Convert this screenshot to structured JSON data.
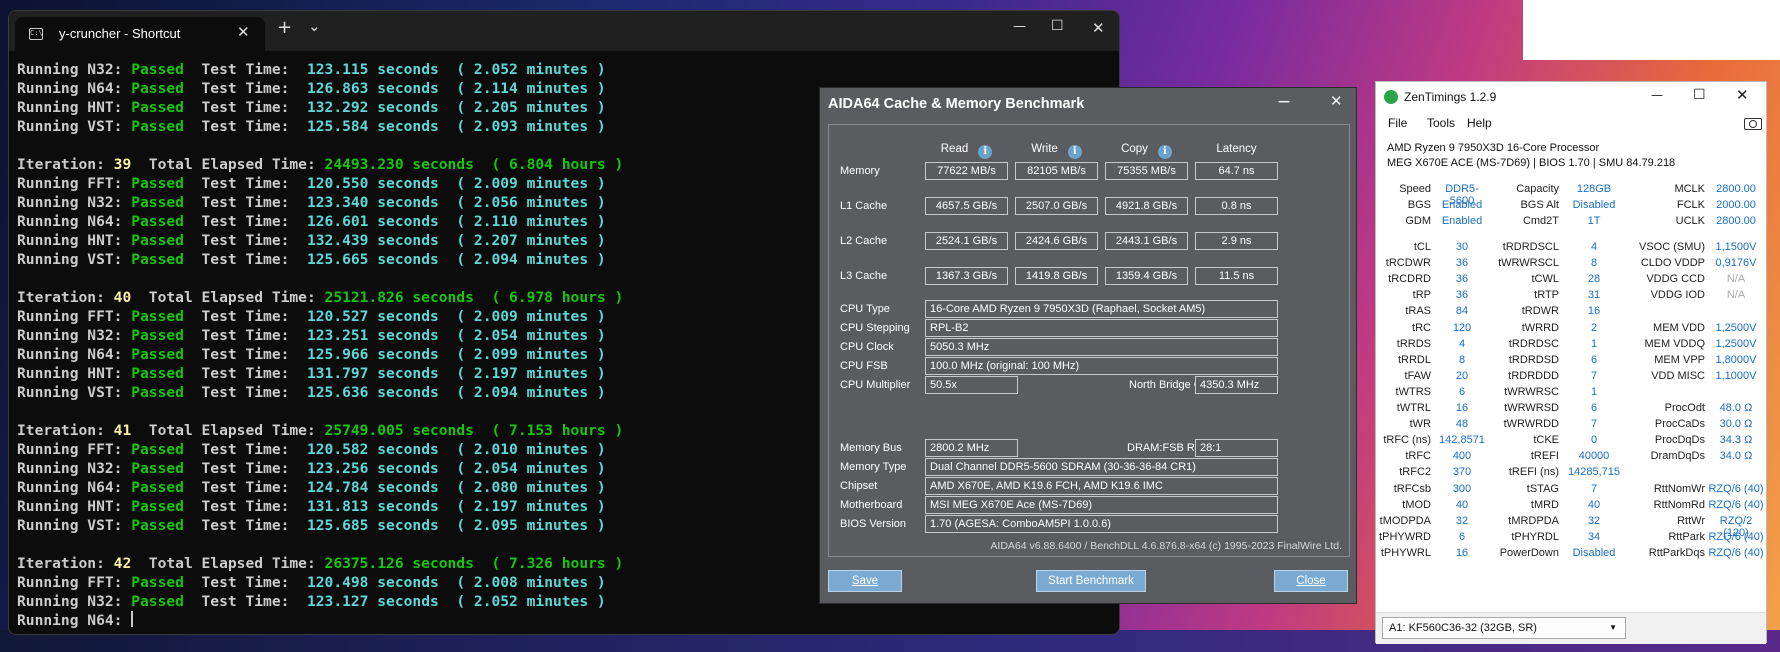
{
  "terminal": {
    "tab_title": "y-cruncher - Shortcut",
    "tab_close": "✕",
    "new_tab": "+",
    "dropdown": "⌄",
    "min": "—",
    "max": "☐",
    "close": "✕",
    "lines": [
      [
        [
          "w",
          "Running N32: "
        ],
        [
          "g",
          "Passed"
        ],
        [
          "w",
          "  Test Time:  "
        ],
        [
          "c",
          "123.115 seconds  ( 2.052 minutes )"
        ]
      ],
      [
        [
          "w",
          "Running N64: "
        ],
        [
          "g",
          "Passed"
        ],
        [
          "w",
          "  Test Time:  "
        ],
        [
          "c",
          "126.863 seconds  ( 2.114 minutes )"
        ]
      ],
      [
        [
          "w",
          "Running HNT: "
        ],
        [
          "g",
          "Passed"
        ],
        [
          "w",
          "  Test Time:  "
        ],
        [
          "c",
          "132.292 seconds  ( 2.205 minutes )"
        ]
      ],
      [
        [
          "w",
          "Running VST: "
        ],
        [
          "g",
          "Passed"
        ],
        [
          "w",
          "  Test Time:  "
        ],
        [
          "c",
          "125.584 seconds  ( 2.093 minutes )"
        ]
      ],
      [],
      [
        [
          "w",
          "Iteration: "
        ],
        [
          "y",
          "39"
        ],
        [
          "w",
          "  Total Elapsed Time: "
        ],
        [
          "g",
          "24493.230 seconds  ( 6.804 hours )"
        ]
      ],
      [
        [
          "w",
          "Running FFT: "
        ],
        [
          "g",
          "Passed"
        ],
        [
          "w",
          "  Test Time:  "
        ],
        [
          "c",
          "120.550 seconds  ( 2.009 minutes )"
        ]
      ],
      [
        [
          "w",
          "Running N32: "
        ],
        [
          "g",
          "Passed"
        ],
        [
          "w",
          "  Test Time:  "
        ],
        [
          "c",
          "123.340 seconds  ( 2.056 minutes )"
        ]
      ],
      [
        [
          "w",
          "Running N64: "
        ],
        [
          "g",
          "Passed"
        ],
        [
          "w",
          "  Test Time:  "
        ],
        [
          "c",
          "126.601 seconds  ( 2.110 minutes )"
        ]
      ],
      [
        [
          "w",
          "Running HNT: "
        ],
        [
          "g",
          "Passed"
        ],
        [
          "w",
          "  Test Time:  "
        ],
        [
          "c",
          "132.439 seconds  ( 2.207 minutes )"
        ]
      ],
      [
        [
          "w",
          "Running VST: "
        ],
        [
          "g",
          "Passed"
        ],
        [
          "w",
          "  Test Time:  "
        ],
        [
          "c",
          "125.665 seconds  ( 2.094 minutes )"
        ]
      ],
      [],
      [
        [
          "w",
          "Iteration: "
        ],
        [
          "y",
          "40"
        ],
        [
          "w",
          "  Total Elapsed Time: "
        ],
        [
          "g",
          "25121.826 seconds  ( 6.978 hours )"
        ]
      ],
      [
        [
          "w",
          "Running FFT: "
        ],
        [
          "g",
          "Passed"
        ],
        [
          "w",
          "  Test Time:  "
        ],
        [
          "c",
          "120.527 seconds  ( 2.009 minutes )"
        ]
      ],
      [
        [
          "w",
          "Running N32: "
        ],
        [
          "g",
          "Passed"
        ],
        [
          "w",
          "  Test Time:  "
        ],
        [
          "c",
          "123.251 seconds  ( 2.054 minutes )"
        ]
      ],
      [
        [
          "w",
          "Running N64: "
        ],
        [
          "g",
          "Passed"
        ],
        [
          "w",
          "  Test Time:  "
        ],
        [
          "c",
          "125.966 seconds  ( 2.099 minutes )"
        ]
      ],
      [
        [
          "w",
          "Running HNT: "
        ],
        [
          "g",
          "Passed"
        ],
        [
          "w",
          "  Test Time:  "
        ],
        [
          "c",
          "131.797 seconds  ( 2.197 minutes )"
        ]
      ],
      [
        [
          "w",
          "Running VST: "
        ],
        [
          "g",
          "Passed"
        ],
        [
          "w",
          "  Test Time:  "
        ],
        [
          "c",
          "125.636 seconds  ( 2.094 minutes )"
        ]
      ],
      [],
      [
        [
          "w",
          "Iteration: "
        ],
        [
          "y",
          "41"
        ],
        [
          "w",
          "  Total Elapsed Time: "
        ],
        [
          "g",
          "25749.005 seconds  ( 7.153 hours )"
        ]
      ],
      [
        [
          "w",
          "Running FFT: "
        ],
        [
          "g",
          "Passed"
        ],
        [
          "w",
          "  Test Time:  "
        ],
        [
          "c",
          "120.582 seconds  ( 2.010 minutes )"
        ]
      ],
      [
        [
          "w",
          "Running N32: "
        ],
        [
          "g",
          "Passed"
        ],
        [
          "w",
          "  Test Time:  "
        ],
        [
          "c",
          "123.256 seconds  ( 2.054 minutes )"
        ]
      ],
      [
        [
          "w",
          "Running N64: "
        ],
        [
          "g",
          "Passed"
        ],
        [
          "w",
          "  Test Time:  "
        ],
        [
          "c",
          "124.784 seconds  ( 2.080 minutes )"
        ]
      ],
      [
        [
          "w",
          "Running HNT: "
        ],
        [
          "g",
          "Passed"
        ],
        [
          "w",
          "  Test Time:  "
        ],
        [
          "c",
          "131.813 seconds  ( 2.197 minutes )"
        ]
      ],
      [
        [
          "w",
          "Running VST: "
        ],
        [
          "g",
          "Passed"
        ],
        [
          "w",
          "  Test Time:  "
        ],
        [
          "c",
          "125.685 seconds  ( 2.095 minutes )"
        ]
      ],
      [],
      [
        [
          "w",
          "Iteration: "
        ],
        [
          "y",
          "42"
        ],
        [
          "w",
          "  Total Elapsed Time: "
        ],
        [
          "g",
          "26375.126 seconds  ( 7.326 hours )"
        ]
      ],
      [
        [
          "w",
          "Running FFT: "
        ],
        [
          "g",
          "Passed"
        ],
        [
          "w",
          "  Test Time:  "
        ],
        [
          "c",
          "120.498 seconds  ( 2.008 minutes )"
        ]
      ],
      [
        [
          "w",
          "Running N32: "
        ],
        [
          "g",
          "Passed"
        ],
        [
          "w",
          "  Test Time:  "
        ],
        [
          "c",
          "123.127 seconds  ( 2.052 minutes )"
        ]
      ],
      [
        [
          "w",
          "Running N64: "
        ]
      ]
    ]
  },
  "aida": {
    "title": "AIDA64 Cache & Memory Benchmark",
    "min": "—",
    "close": "✕",
    "headers": {
      "read": "Read",
      "write": "Write",
      "copy": "Copy",
      "latency": "Latency",
      "info": "i"
    },
    "rows": [
      {
        "label": "Memory",
        "read": "77622 MB/s",
        "write": "82105 MB/s",
        "copy": "75355 MB/s",
        "latency": "64.7 ns"
      },
      {
        "label": "L1 Cache",
        "read": "4657.5 GB/s",
        "write": "2507.0 GB/s",
        "copy": "4921.8 GB/s",
        "latency": "0.8 ns"
      },
      {
        "label": "L2 Cache",
        "read": "2524.1 GB/s",
        "write": "2424.6 GB/s",
        "copy": "2443.1 GB/s",
        "latency": "2.9 ns"
      },
      {
        "label": "L3 Cache",
        "read": "1367.3 GB/s",
        "write": "1419.8 GB/s",
        "copy": "1359.4 GB/s",
        "latency": "11.5 ns"
      }
    ],
    "cpu_type_label": "CPU Type",
    "cpu_type": "16-Core AMD Ryzen 9 7950X3D  (Raphael, Socket AM5)",
    "cpu_stepping_label": "CPU Stepping",
    "cpu_stepping": "RPL-B2",
    "cpu_clock_label": "CPU Clock",
    "cpu_clock": "5050.3 MHz",
    "cpu_fsb_label": "CPU FSB",
    "cpu_fsb": "100.0 MHz  (original: 100 MHz)",
    "cpu_mult_label": "CPU Multiplier",
    "cpu_mult": "50.5x",
    "nb_clock_label": "North Bridge Clock",
    "nb_clock": "4350.3 MHz",
    "mem_bus_label": "Memory Bus",
    "mem_bus": "2800.2 MHz",
    "dram_fsb_label": "DRAM:FSB Ratio",
    "dram_fsb": "28:1",
    "mem_type_label": "Memory Type",
    "mem_type": "Dual Channel DDR5-5600 SDRAM  (30-36-36-84 CR1)",
    "chipset_label": "Chipset",
    "chipset": "AMD X670E, AMD K19.6 FCH, AMD K19.6 IMC",
    "mobo_label": "Motherboard",
    "mobo": "MSI MEG X670E Ace (MS-7D69)",
    "bios_label": "BIOS Version",
    "bios": "1.70  (AGESA: ComboAM5PI 1.0.0.6)",
    "footer": "AIDA64 v6.88.6400 / BenchDLL 4.6.876.8-x64  (c) 1995-2023 FinalWire Ltd.",
    "save": "Save",
    "start": "Start Benchmark",
    "close_btn": "Close"
  },
  "zen": {
    "title": "ZenTimings 1.2.9",
    "min": "—",
    "max": "☐",
    "close": "✕",
    "menu": [
      "File",
      "Tools",
      "Help"
    ],
    "cpu": "AMD Ryzen 9 7950X3D 16-Core Processor",
    "board": "MEG X670E ACE (MS-7D69) | BIOS 1.70 | SMU 84.79.218",
    "top": [
      [
        "Speed",
        "DDR5-5600",
        "Capacity",
        "128GB",
        "MCLK",
        "2800.00"
      ],
      [
        "BGS",
        "Enabled",
        "BGS Alt",
        "Disabled",
        "FCLK",
        "2000.00"
      ],
      [
        "GDM",
        "Enabled",
        "Cmd2T",
        "1T",
        "UCLK",
        "2800.00"
      ]
    ],
    "rows": [
      [
        "tCL",
        "30",
        "tRDRDSCL",
        "4",
        "VSOC (SMU)",
        "1,1500V"
      ],
      [
        "tRCDWR",
        "36",
        "tWRWRSCL",
        "8",
        "CLDO VDDP",
        "0,9176V"
      ],
      [
        "tRCDRD",
        "36",
        "tCWL",
        "28",
        "VDDG CCD",
        "N/A"
      ],
      [
        "tRP",
        "36",
        "tRTP",
        "31",
        "VDDG IOD",
        "N/A"
      ],
      [
        "tRAS",
        "84",
        "tRDWR",
        "16",
        "",
        ""
      ],
      [
        "tRC",
        "120",
        "tWRRD",
        "2",
        "MEM VDD",
        "1,2500V"
      ],
      [
        "tRRDS",
        "4",
        "tRDRDSC",
        "1",
        "MEM VDDQ",
        "1,2500V"
      ],
      [
        "tRRDL",
        "8",
        "tRDRDSD",
        "6",
        "MEM VPP",
        "1,8000V"
      ],
      [
        "tFAW",
        "20",
        "tRDRDDD",
        "7",
        "VDD MISC",
        "1,1000V"
      ],
      [
        "tWTRS",
        "6",
        "tWRWRSC",
        "1",
        "",
        ""
      ],
      [
        "tWTRL",
        "16",
        "tWRWRSD",
        "6",
        "ProcOdt",
        "48.0 Ω"
      ],
      [
        "tWR",
        "48",
        "tWRWRDD",
        "7",
        "ProcCaDs",
        "30.0 Ω"
      ],
      [
        "tRFC (ns)",
        "142,8571",
        "tCKE",
        "0",
        "ProcDqDs",
        "34.3 Ω"
      ],
      [
        "tRFC",
        "400",
        "tREFI",
        "40000",
        "DramDqDs",
        "34.0 Ω"
      ],
      [
        "tRFC2",
        "370",
        "tREFI (ns)",
        "14285,715",
        "",
        ""
      ],
      [
        "tRFCsb",
        "300",
        "tSTAG",
        "7",
        "RttNomWr",
        "RZQ/6 (40)"
      ],
      [
        "tMOD",
        "40",
        "tMRD",
        "40",
        "RttNomRd",
        "RZQ/6 (40)"
      ],
      [
        "tMODPDA",
        "32",
        "tMRDPDA",
        "32",
        "RttWr",
        "RZQ/2 (120)"
      ],
      [
        "tPHYWRD",
        "6",
        "tPHYRDL",
        "34",
        "RttPark",
        "RZQ/6 (40)"
      ],
      [
        "tPHYWRL",
        "16",
        "PowerDown",
        "Disabled",
        "RttParkDqs",
        "RZQ/6 (40)"
      ]
    ],
    "dimm": "A1: KF560C36-32 (32GB, SR)"
  }
}
